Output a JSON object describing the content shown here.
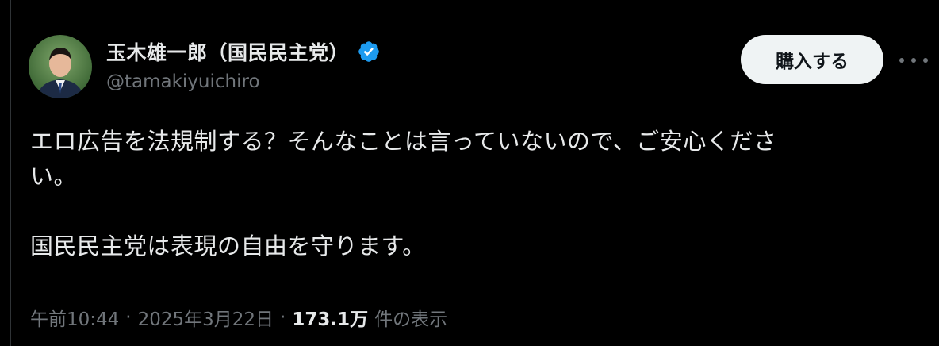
{
  "author": {
    "display_name": "玉木雄一郎（国民民主党）",
    "handle": "@tamakiyuichiro",
    "verified": true
  },
  "actions": {
    "buy_label": "購入する"
  },
  "tweet": {
    "line1": "エロ広告を法規制する？そんなことは言っていないので、ご安心くださ",
    "line2": "い。",
    "line3": "国民民主党は表現の自由を守ります。"
  },
  "meta": {
    "time": "午前10:44",
    "separator": "·",
    "date": "2025年3月22日",
    "views_count": "173.1万",
    "views_label": "件の表示"
  },
  "colors": {
    "background": "#000000",
    "text": "#e7e9ea",
    "secondary_text": "#71767b",
    "verified_blue": "#1d9bf0",
    "button_bg": "#eff3f4"
  }
}
